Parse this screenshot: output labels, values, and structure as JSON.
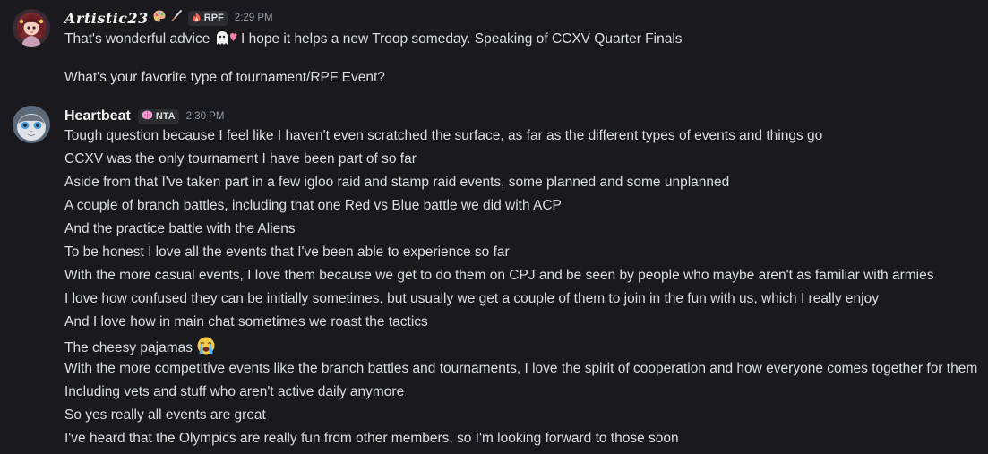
{
  "messages": [
    {
      "author": "Artistic23",
      "tag": "RPF",
      "time": "2:29 PM",
      "lines": [
        "That's wonderful advice",
        "I hope it helps a new Troop someday. Speaking of CCXV Quarter Finals",
        "What's your favorite type of tournament/RPF Event?"
      ]
    },
    {
      "author": "Heartbeat",
      "tag": "NTA",
      "time": "2:30 PM",
      "lines": [
        "Tough question because I feel like I haven't even scratched the surface, as far as the different types of events and things go",
        "CCXV was the only tournament I have been part of so far",
        "Aside from that I've taken part in a few igloo raid and stamp raid events, some planned and some unplanned",
        "A couple of branch battles, including that one Red vs Blue battle we did with ACP",
        "And the practice battle with the Aliens",
        "To be honest I love all the events that I've been able to experience so far",
        "With the more casual events, I love them because we get to do them on CPJ and be seen by people who maybe aren't as familiar with armies",
        "I love how confused they can be initially sometimes, but usually we get a couple of them to join in the fun with us, which I really enjoy",
        "And I love how in main chat sometimes we roast the tactics",
        "The cheesy pajamas",
        "With the more competitive events like the branch battles and tournaments, I love the spirit of cooperation and how everyone comes together for them",
        "Including vets and stuff who aren't active daily anymore",
        "So yes really all events are great",
        "I've heard that the Olympics are really fun from other members, so I'm looking forward to those soon"
      ]
    }
  ],
  "icons": {
    "artistic_avatar": "avatar-girl-icon",
    "heartbeat_avatar": "avatar-cat-icon",
    "palette": "palette-icon",
    "brush": "paintbrush-icon",
    "rpf_tag": "flame-icon",
    "nta_tag": "brain-icon",
    "advice_emoji": "ghost-heart-emoji",
    "crying_emoji": "loudly-crying-emoji"
  },
  "colors": {
    "background": "#1a1a1e",
    "text": "#dbdee1",
    "username": "#f2f3f5",
    "timestamp": "#949ba4",
    "tag_bg": "#2b2d31"
  }
}
